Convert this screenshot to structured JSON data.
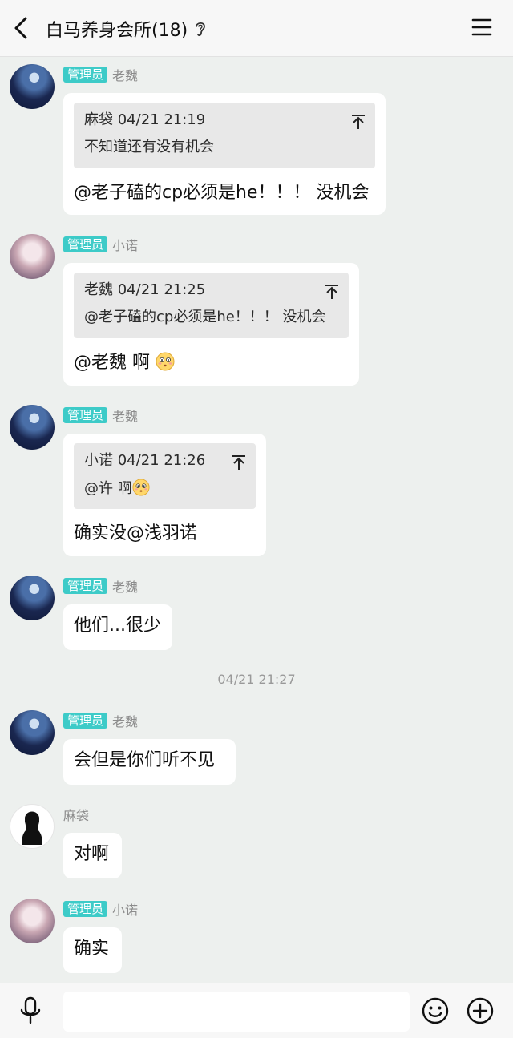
{
  "header": {
    "title": "白马养身会所(18)"
  },
  "messages": [
    {
      "sender": "老魏",
      "badge": "管理员",
      "quote": {
        "head": "麻袋 04/21 21:19",
        "body": "不知道还有没有机会"
      },
      "text": "@老子磕的cp必须是he！！！ 没机会"
    },
    {
      "sender": "小诺",
      "badge": "管理员",
      "quote": {
        "head": "老魏 04/21 21:25",
        "body": "@老子磕的cp必须是he！！！ 没机会"
      },
      "text": "@老魏 啊"
    },
    {
      "sender": "老魏",
      "badge": "管理员",
      "quote": {
        "head": "小诺 04/21 21:26",
        "body": "@许 啊"
      },
      "text": "确实没@浅羽诺"
    },
    {
      "sender": "老魏",
      "badge": "管理员",
      "text": "他们...很少"
    },
    {
      "sender": "老魏",
      "badge": "管理员",
      "text": "会但是你们听不见"
    },
    {
      "sender": "麻袋",
      "text": "对啊"
    },
    {
      "sender": "小诺",
      "badge": "管理员",
      "text": "确实"
    }
  ],
  "timestamp": "04/21 21:27",
  "icons": {
    "back": "back-arrow-icon",
    "ear": "ear-icon",
    "menu": "menu-icon",
    "pin": "pin-to-top-icon",
    "emoji": "flushed-face-emoji",
    "mic": "microphone-icon",
    "smile": "smile-icon",
    "plus": "plus-icon"
  },
  "colors": {
    "badge": "#3dcbc8",
    "background": "#edf0ee",
    "bubble": "#ffffff",
    "quote": "#e8e8e8"
  }
}
